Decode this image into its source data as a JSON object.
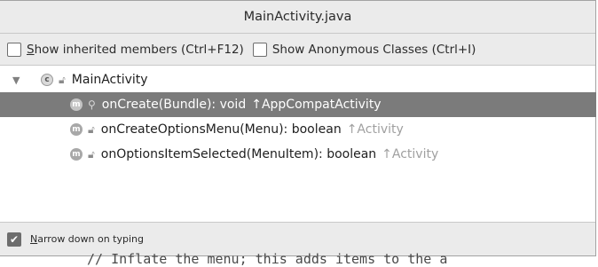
{
  "popup": {
    "title": "MainActivity.java",
    "options": {
      "inherited_label": "Show inherited members (Ctrl+F12)",
      "anonymous_label": "Show Anonymous Classes (Ctrl+I)"
    },
    "tree": {
      "root": {
        "badge": "c",
        "name": "MainActivity"
      },
      "members": [
        {
          "badge": "m",
          "signature": "onCreate(Bundle): void",
          "origin": "↑AppCompatActivity",
          "selected": true
        },
        {
          "badge": "m",
          "signature": "onCreateOptionsMenu(Menu): boolean",
          "origin": "↑Activity",
          "selected": false
        },
        {
          "badge": "m",
          "signature": "onOptionsItemSelected(MenuItem): boolean",
          "origin": "↑Activity",
          "selected": false
        }
      ]
    },
    "footer": {
      "narrow_label": "Narrow down on typing",
      "narrow_checked": true
    }
  },
  "editor": {
    "partial_line": "// Inflate the menu; this adds items to the a"
  }
}
